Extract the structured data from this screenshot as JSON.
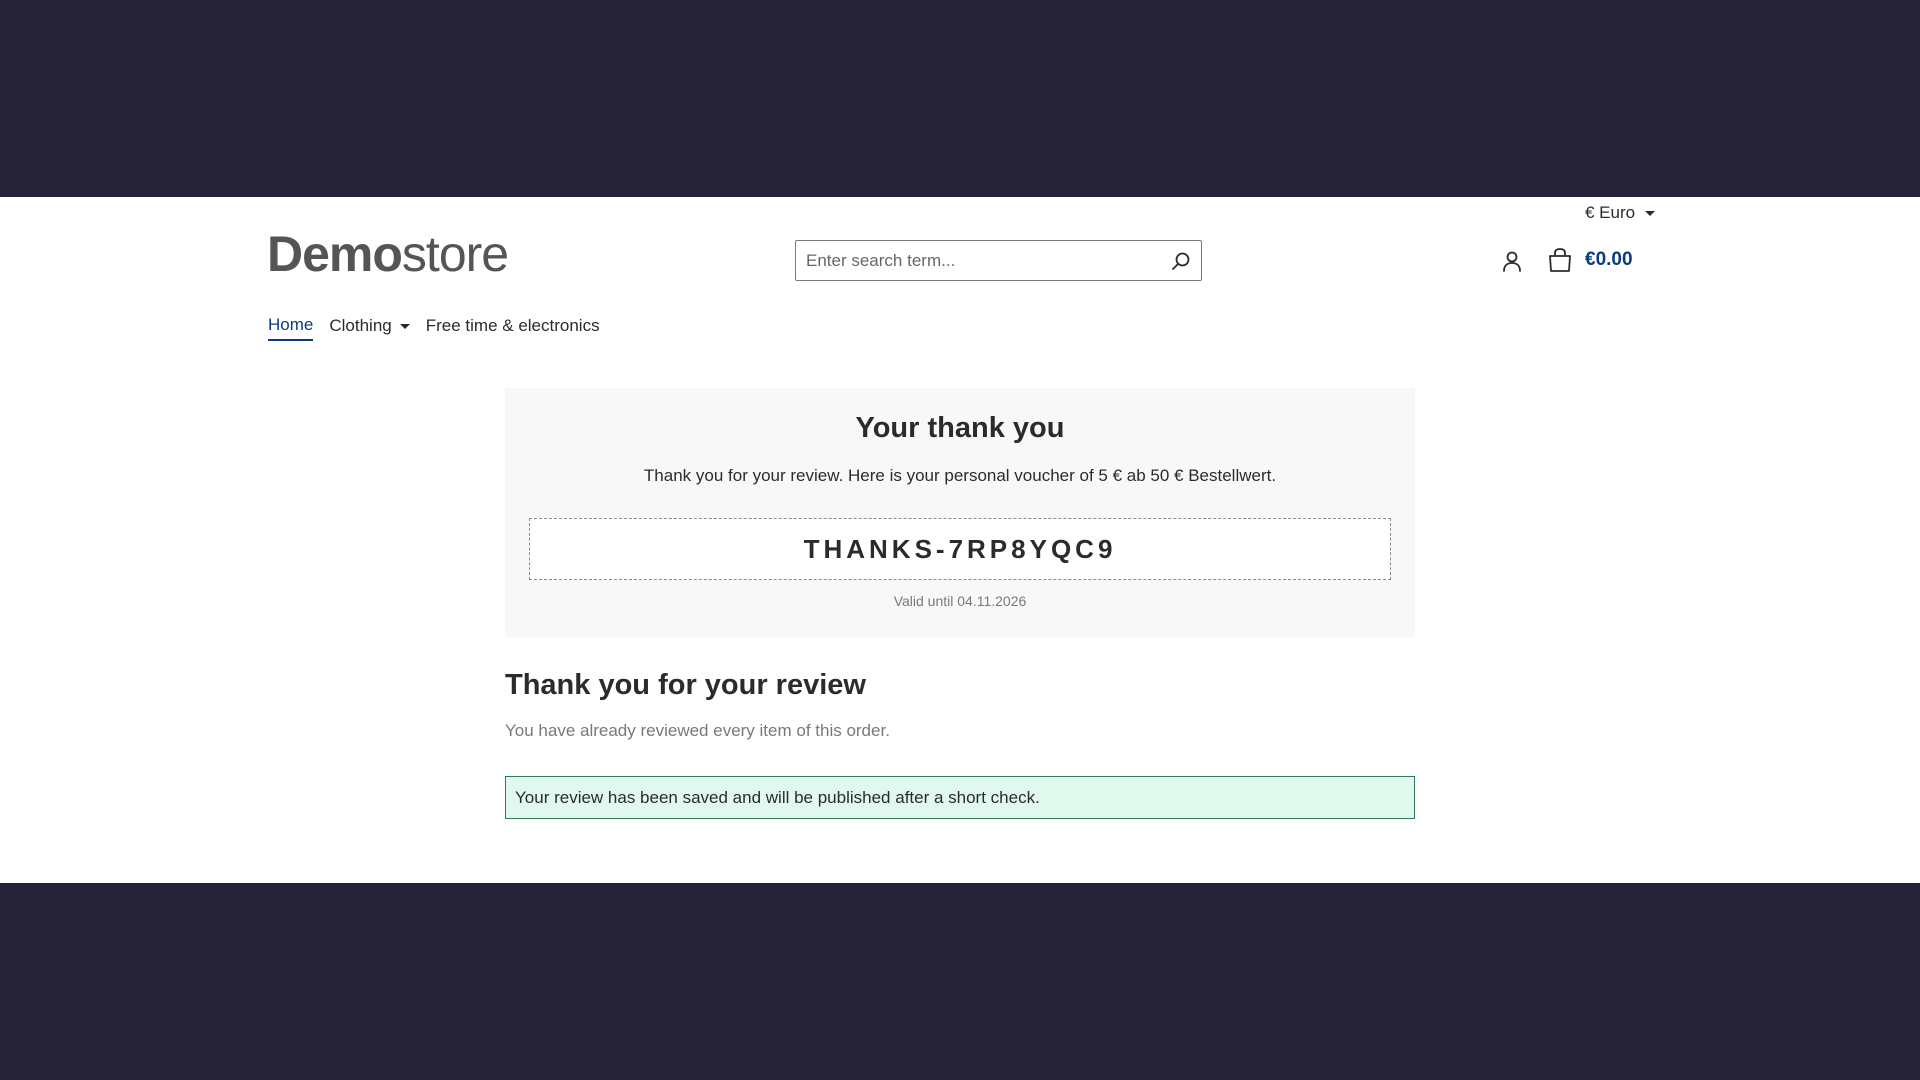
{
  "header": {
    "currency_label": "€ Euro",
    "logo_bold": "Demo",
    "logo_light": "store",
    "search_placeholder": "Enter search term...",
    "cart_total": "€0.00"
  },
  "nav": {
    "items": [
      {
        "label": "Home",
        "active": true
      },
      {
        "label": "Clothing",
        "has_dropdown": true
      },
      {
        "label": "Free time & electronics"
      }
    ]
  },
  "voucher": {
    "title": "Your thank you",
    "text": "Thank you for your review. Here is your personal voucher of 5 € ab 50 € Bestellwert.",
    "code": "THANKS-7RP8YQC9",
    "valid_until": "Valid until 04.11.2026"
  },
  "review": {
    "title": "Thank you for your review",
    "subtitle": "You have already reviewed every item of this order.",
    "success_message": "Your review has been saved and will be published after a short check."
  },
  "colors": {
    "backdrop": "#262338",
    "accent": "#0b3a82",
    "success_bg": "#e0f8ee",
    "success_border": "#2e7d57"
  }
}
